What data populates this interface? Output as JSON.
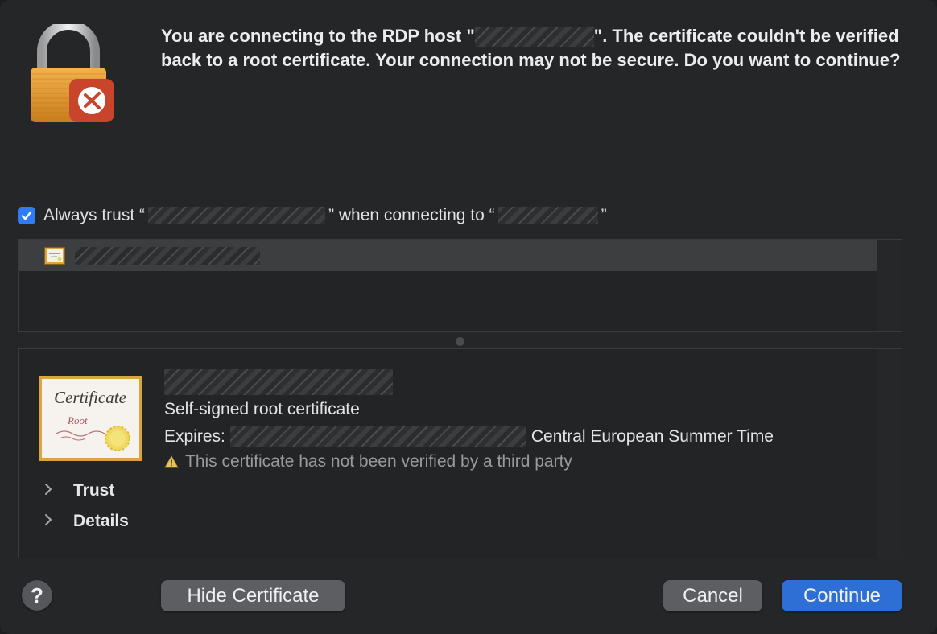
{
  "message": {
    "part1": "You are connecting to the RDP host \"",
    "part2": "\". The certificate couldn't be verified back to a root certificate. Your connection may not be secure. Do you want to continue?"
  },
  "trust": {
    "checked": true,
    "prefix": "Always trust “",
    "middle": "” when connecting to “",
    "suffix": "”"
  },
  "certificate": {
    "image_title": "Certificate",
    "image_subtitle": "Root",
    "kind": "Self-signed root certificate",
    "expires_label": "Expires:",
    "expires_timezone": "Central European Summer Time",
    "warning": "This certificate has not been verified by a third party"
  },
  "disclosures": {
    "trust": "Trust",
    "details": "Details"
  },
  "buttons": {
    "help": "?",
    "hide_certificate": "Hide Certificate",
    "cancel": "Cancel",
    "continue": "Continue"
  },
  "colors": {
    "accent": "#2f7cf6",
    "primary_button": "#2e6fd6",
    "dialog_background": "#242628",
    "warning_yellow": "#e8c45a"
  }
}
